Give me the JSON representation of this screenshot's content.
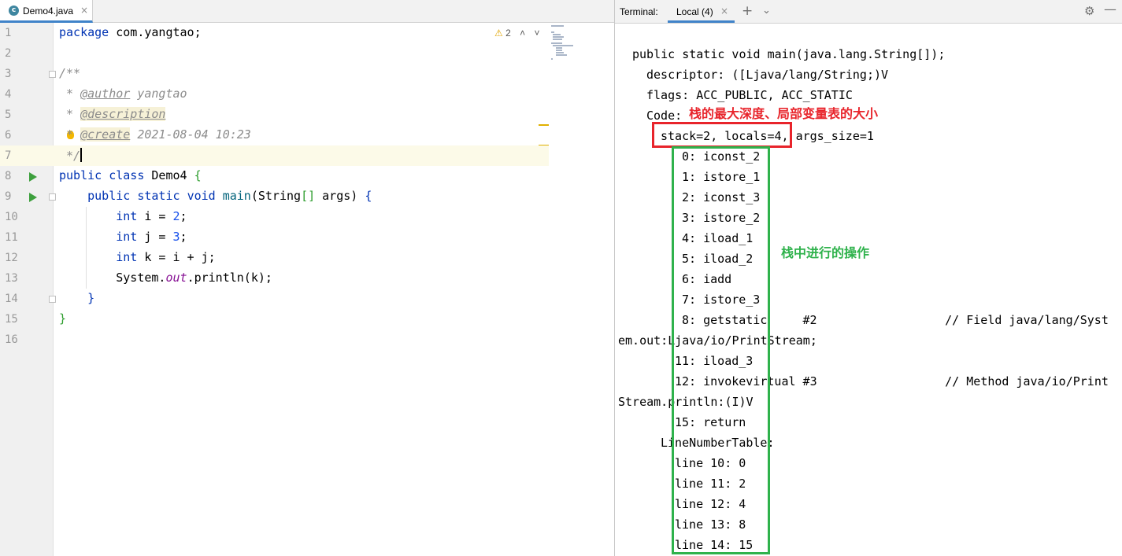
{
  "editor": {
    "tab": {
      "icon_letter": "c",
      "filename": "Demo4.java",
      "close": "×"
    },
    "inspection": {
      "warning_icon": "⚠",
      "count": "2",
      "up": "˄",
      "down": "˅"
    },
    "line_numbers": [
      "1",
      "2",
      "3",
      "4",
      "5",
      "6",
      "7",
      "8",
      "9",
      "10",
      "11",
      "12",
      "13",
      "14",
      "15",
      "16"
    ],
    "code": {
      "l1_kw": "package",
      "l1_rest": " com.yangtao;",
      "l3": "/**",
      "l4_star": " * ",
      "l4_tag": "@author",
      "l4_rest": " yangtao",
      "l5_star": " * ",
      "l5_tag": "@description",
      "l6_star": " * ",
      "l6_tag": "@create",
      "l6_rest": " 2021-08-04 10:23",
      "l7": " */",
      "l8_kw1": "public",
      "l8_kw2": "class",
      "l8_name": " Demo4 ",
      "l8_brace": "{",
      "l9_kw1": "public",
      "l9_kw2": "static",
      "l9_kw3": "void",
      "l9_fn": "main",
      "l9_p1": "(String",
      "l9_arr": "[]",
      "l9_p2": " args) ",
      "l9_brace": "{",
      "l10_kw": "int",
      "l10_mid": " i = ",
      "l10_num": "2",
      "l10_end": ";",
      "l11_kw": "int",
      "l11_mid": " j = ",
      "l11_num": "3",
      "l11_end": ";",
      "l12_kw": "int",
      "l12_mid": " k = i + j;",
      "l13_a": "System.",
      "l13_fld": "out",
      "l13_b": ".println(k);",
      "l14": "}",
      "l15": "}"
    }
  },
  "terminal": {
    "title": "Terminal:",
    "tab_label": "Local (4)",
    "tab_close": "×",
    "add": "+",
    "menu": "⌄",
    "gear": "⚙",
    "minimize": "—",
    "lines": [
      "public static void main(java.lang.String[]);",
      "descriptor: ([Ljava/lang/String;)V",
      "flags: ACC_PUBLIC, ACC_STATIC",
      "Code:",
      "stack=2, locals=4, args_size=1",
      "0: iconst_2",
      "1: istore_1",
      "2: iconst_3",
      "3: istore_2",
      "4: iload_1",
      "5: iload_2",
      "6: iadd",
      "7: istore_3",
      "8: getstatic     #2                  // Field java/lang/Syst",
      "em.out:Ljava/io/PrintStream;",
      "11: iload_3",
      "12: invokevirtual #3                  // Method java/io/Print",
      "Stream.println:(I)V",
      "15: return",
      "LineNumberTable:",
      "line 10: 0",
      "line 11: 2",
      "line 12: 4",
      "line 13: 8",
      "line 14: 15"
    ],
    "annotation_red": "栈的最大深度、局部变量表的大小",
    "annotation_green": "栈中进行的操作",
    "colors": {
      "red": "#e8242b",
      "green": "#2fb24c"
    }
  }
}
